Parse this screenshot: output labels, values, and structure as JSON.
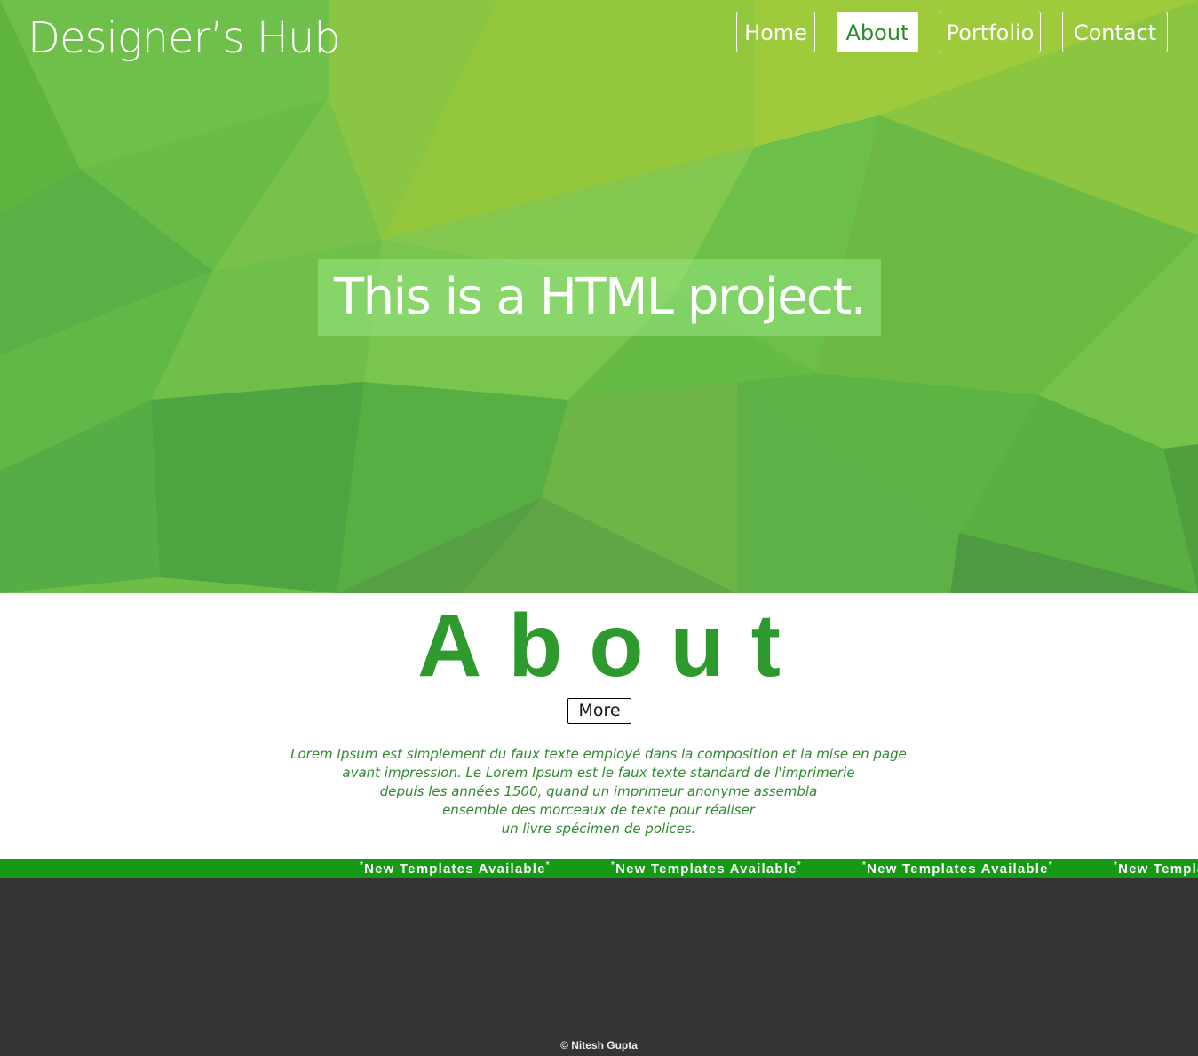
{
  "header": {
    "brand": "Designer’s Hub",
    "nav": [
      {
        "label": "Home",
        "active": false
      },
      {
        "label": "About",
        "active": true
      },
      {
        "label": "Portfolio",
        "active": false
      },
      {
        "label": "Contact",
        "active": false
      }
    ]
  },
  "hero": {
    "title": "This is a HTML project."
  },
  "about": {
    "heading": "About",
    "more_label": "More",
    "text_lines": [
      "Lorem Ipsum est simplement du faux texte employé dans la composition et la mise en page",
      "avant impression. Le Lorem Ipsum est le faux texte standard de l'imprimerie",
      "depuis les années 1500, quand un imprimeur anonyme assembla",
      "ensemble des morceaux de texte pour réaliser",
      "un livre spécimen de polices."
    ]
  },
  "ticker": {
    "marker": "*",
    "items": [
      "New Templates Available",
      "New Templates Available",
      "New Templates Available",
      "New Templates Available"
    ]
  },
  "footer": {
    "copyright": "© Nitesh Gupta"
  },
  "colors": {
    "hero_green": "#6bbf45",
    "accent_green": "#2e9a2e",
    "ticker_green": "#169a16",
    "footer_dark": "#343434"
  }
}
